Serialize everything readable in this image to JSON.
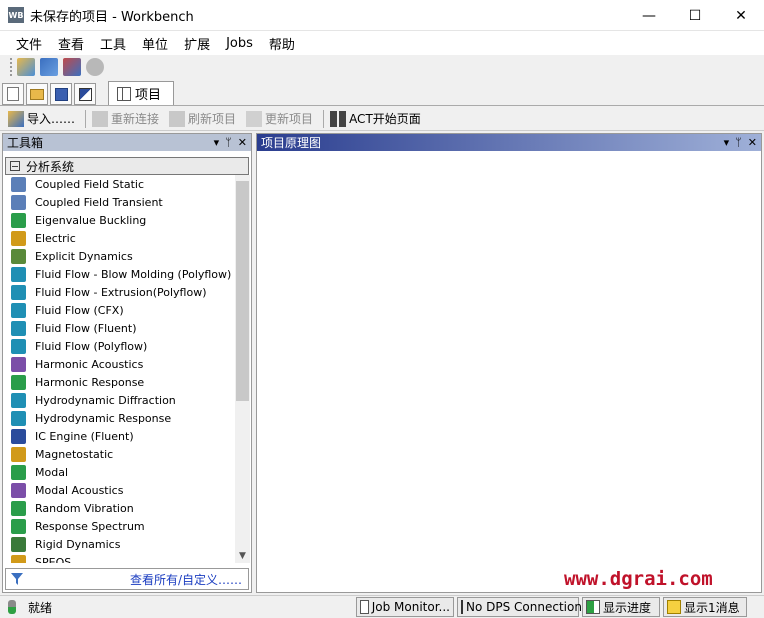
{
  "window": {
    "title": "未保存的项目 - Workbench",
    "app_icon": "WB",
    "minimize": "—",
    "maximize": "☐",
    "close": "✕"
  },
  "menu": [
    "文件",
    "查看",
    "工具",
    "单位",
    "扩展",
    "Jobs",
    "帮助"
  ],
  "project_tab": {
    "label": "项目"
  },
  "toolbar2": {
    "import": "导入……",
    "reconnect": "重新连接",
    "refresh": "刷新项目",
    "update": "更新项目",
    "act": "ACT开始页面"
  },
  "toolbox": {
    "title": "工具箱",
    "controls": [
      "▾",
      "ᛘ",
      "✕"
    ],
    "group": "分析系统",
    "items": [
      {
        "label": "Coupled Field Static",
        "color": "#5b7fb8"
      },
      {
        "label": "Coupled Field Transient",
        "color": "#5b7fb8"
      },
      {
        "label": "Eigenvalue Buckling",
        "color": "#2a9d4a"
      },
      {
        "label": "Electric",
        "color": "#d19a1a"
      },
      {
        "label": "Explicit Dynamics",
        "color": "#5a8a3a"
      },
      {
        "label": "Fluid Flow - Blow Molding (Polyflow)",
        "color": "#1f8fb4"
      },
      {
        "label": "Fluid Flow - Extrusion(Polyflow)",
        "color": "#1f8fb4"
      },
      {
        "label": "Fluid Flow (CFX)",
        "color": "#1f8fb4"
      },
      {
        "label": "Fluid Flow (Fluent)",
        "color": "#1f8fb4"
      },
      {
        "label": "Fluid Flow (Polyflow)",
        "color": "#1f8fb4"
      },
      {
        "label": "Harmonic Acoustics",
        "color": "#7b4ea8"
      },
      {
        "label": "Harmonic Response",
        "color": "#2a9d4a"
      },
      {
        "label": "Hydrodynamic Diffraction",
        "color": "#1f8fb4"
      },
      {
        "label": "Hydrodynamic Response",
        "color": "#1f8fb4"
      },
      {
        "label": "IC Engine (Fluent)",
        "color": "#2b4c9c"
      },
      {
        "label": "Magnetostatic",
        "color": "#d19a1a"
      },
      {
        "label": "Modal",
        "color": "#2a9d4a"
      },
      {
        "label": "Modal Acoustics",
        "color": "#7b4ea8"
      },
      {
        "label": "Random Vibration",
        "color": "#2a9d4a"
      },
      {
        "label": "Response Spectrum",
        "color": "#2a9d4a"
      },
      {
        "label": "Rigid Dynamics",
        "color": "#3a7a3a"
      },
      {
        "label": "SPEOS",
        "color": "#d19a1a"
      }
    ],
    "view_all": "查看所有/自定义……"
  },
  "schematic": {
    "title": "项目原理图",
    "controls": [
      "▾",
      "ᛘ",
      "✕"
    ]
  },
  "watermark": "www.dgrai.com",
  "status": {
    "text": "就绪",
    "job_monitor": "Job Monitor...",
    "dps": "No DPS Connection",
    "progress": "显示进度",
    "messages": "显示1消息"
  }
}
